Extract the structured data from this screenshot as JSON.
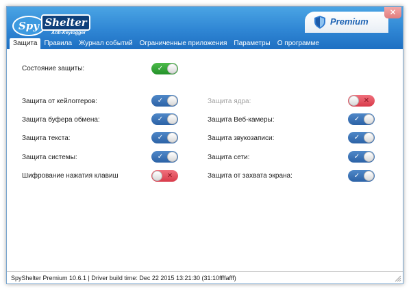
{
  "app": {
    "logo_part1": "Spy",
    "logo_part2": "Shelter",
    "logo_sub": "Anti-Keylogger",
    "edition": "Premium",
    "close_glyph": "✕"
  },
  "tabs": [
    {
      "label": "Защита",
      "active": true
    },
    {
      "label": "Правила",
      "active": false
    },
    {
      "label": "Журнал событий",
      "active": false
    },
    {
      "label": "Ограниченные приложения",
      "active": false
    },
    {
      "label": "Параметры",
      "active": false
    },
    {
      "label": "О программе",
      "active": false
    }
  ],
  "status_row": {
    "label": "Состояние защиты:",
    "state": "on",
    "color": "green"
  },
  "left_column": [
    {
      "label": "Защита от кейлоггеров:",
      "state": "on",
      "disabled": false
    },
    {
      "label": "Защита буфера обмена:",
      "state": "on",
      "disabled": false
    },
    {
      "label": "Защита текста:",
      "state": "on",
      "disabled": false
    },
    {
      "label": "Защита системы:",
      "state": "on",
      "disabled": false
    },
    {
      "label": "Шифрование нажатия клавиш",
      "state": "off",
      "disabled": false
    }
  ],
  "right_column": [
    {
      "label": "Защита ядра:",
      "state": "off",
      "disabled": true
    },
    {
      "label": "Защита Веб-камеры:",
      "state": "on",
      "disabled": false
    },
    {
      "label": "Защита звукозаписи:",
      "state": "on",
      "disabled": false
    },
    {
      "label": "Защита сети:",
      "state": "on",
      "disabled": false
    },
    {
      "label": "Защита от захвата экрана:",
      "state": "on",
      "disabled": false
    }
  ],
  "statusbar": {
    "text": "SpyShelter Premium 10.6.1  |  Driver build time: Dec 22 2015 13:21:30  (31:10ffffafff)"
  },
  "colors": {
    "header_blue": "#2f86d4",
    "toggle_on": "#2c62a6",
    "toggle_green": "#23912a",
    "toggle_off": "#d83a4a"
  }
}
